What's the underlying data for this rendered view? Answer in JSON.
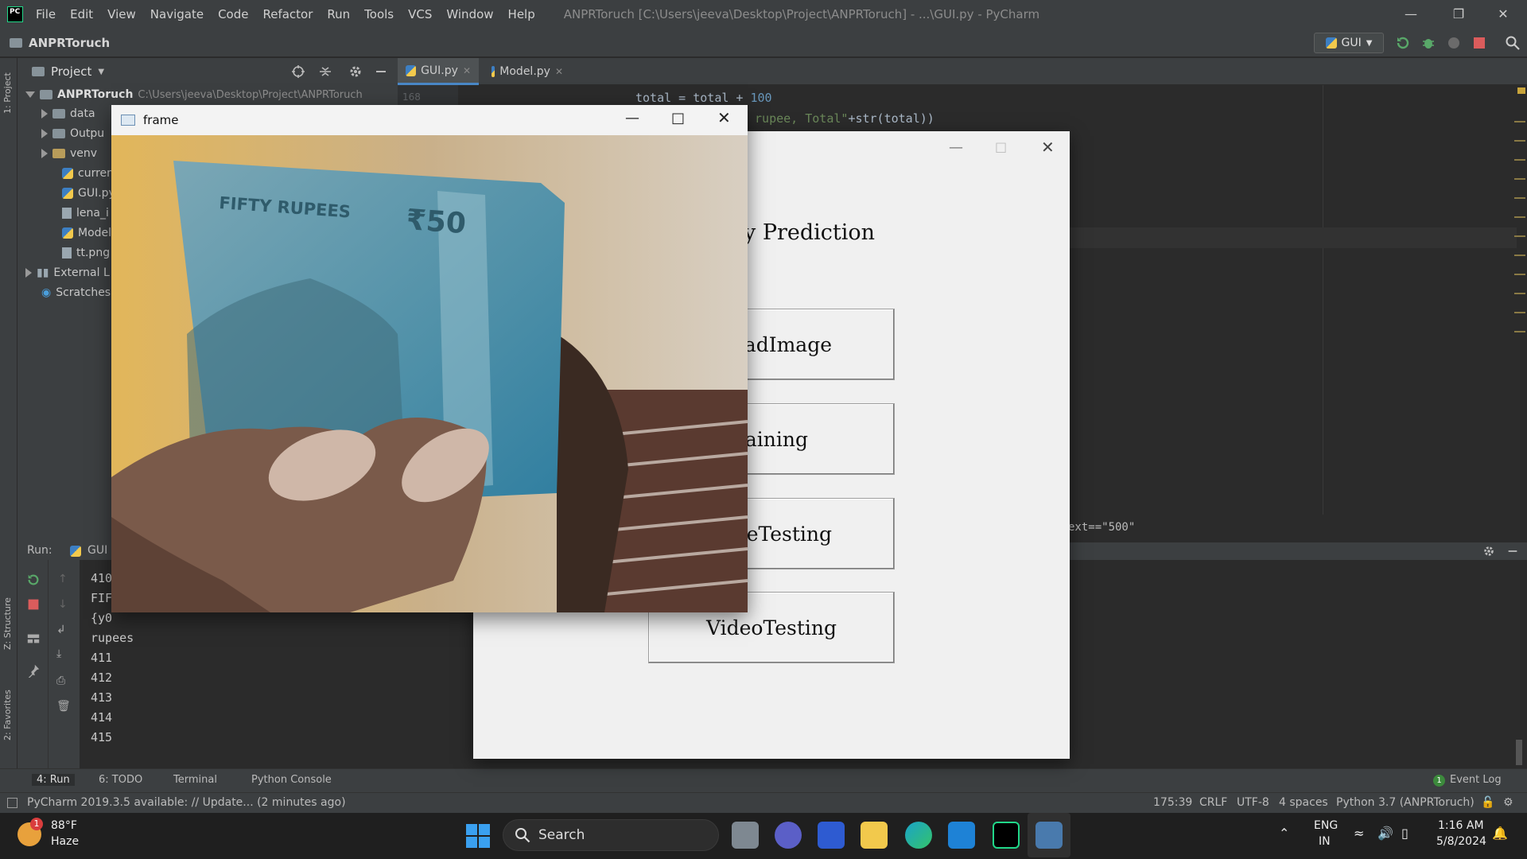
{
  "menubar": {
    "items": [
      "File",
      "Edit",
      "View",
      "Navigate",
      "Code",
      "Refactor",
      "Run",
      "Tools",
      "VCS",
      "Window",
      "Help"
    ],
    "window_title": "ANPRToruch [C:\\Users\\jeeva\\Desktop\\Project\\ANPRToruch] - ...\\GUI.py - PyCharm"
  },
  "navbar": {
    "project": "ANPRToruch",
    "run_config": "GUI"
  },
  "left_strip": {
    "project_label": "1: Project",
    "structure_label": "Z: Structure",
    "favorites_label": "2: Favorites"
  },
  "project_panel": {
    "title": "Project",
    "root_name": "ANPRToruch",
    "root_path": "C:\\Users\\jeeva\\Desktop\\Project\\ANPRToruch",
    "items": [
      {
        "label": "data"
      },
      {
        "label": "Outpu"
      },
      {
        "label": "venv"
      },
      {
        "label": "curren"
      },
      {
        "label": "GUI.py"
      },
      {
        "label": "lena_i"
      },
      {
        "label": "Model"
      },
      {
        "label": "tt.png"
      },
      {
        "label": "External L"
      },
      {
        "label": "Scratches"
      }
    ]
  },
  "editor": {
    "tabs": [
      {
        "label": "GUI.py"
      },
      {
        "label": "Model.py"
      }
    ],
    "line_number": "168",
    "code_line1_a": "total = total + ",
    "code_line1_num": "100",
    "code_line2_str": " rupee, Total\"",
    "code_line2_b": "+str(total))",
    "code_line3": "ext==\"500\""
  },
  "run_panel": {
    "label": "Run:",
    "tab": "GUI",
    "output": [
      "410",
      "FIF",
      "{y0",
      "rupees",
      "411",
      "412",
      "413",
      "414",
      "415"
    ]
  },
  "tool_tabs": [
    "4: Run",
    "6: TODO",
    "Terminal",
    "Python Console"
  ],
  "event_log": {
    "label": "Event Log",
    "count": "1"
  },
  "status_bar": {
    "message": "PyCharm 2019.3.5 available: // Update... (2 minutes ago)",
    "position": "175:39",
    "line_sep": "CRLF",
    "encoding": "UTF-8",
    "indent": "4 spaces",
    "interpreter": "Python 3.7 (ANPRToruch)"
  },
  "gui_window": {
    "title_text": "y Prediction",
    "buttons": [
      "badImage",
      "raining",
      "geTesting",
      "VideoTesting"
    ]
  },
  "frame_window": {
    "title": "frame",
    "note_text1": "FIFTY RUPEES",
    "note_text2": "₹50"
  },
  "taskbar": {
    "weather_temp": "88°F",
    "weather_desc": "Haze",
    "weather_badge": "1",
    "search_label": "Search",
    "lang_line1": "ENG",
    "lang_line2": "IN",
    "time": "1:16 AM",
    "date": "5/8/2024"
  }
}
